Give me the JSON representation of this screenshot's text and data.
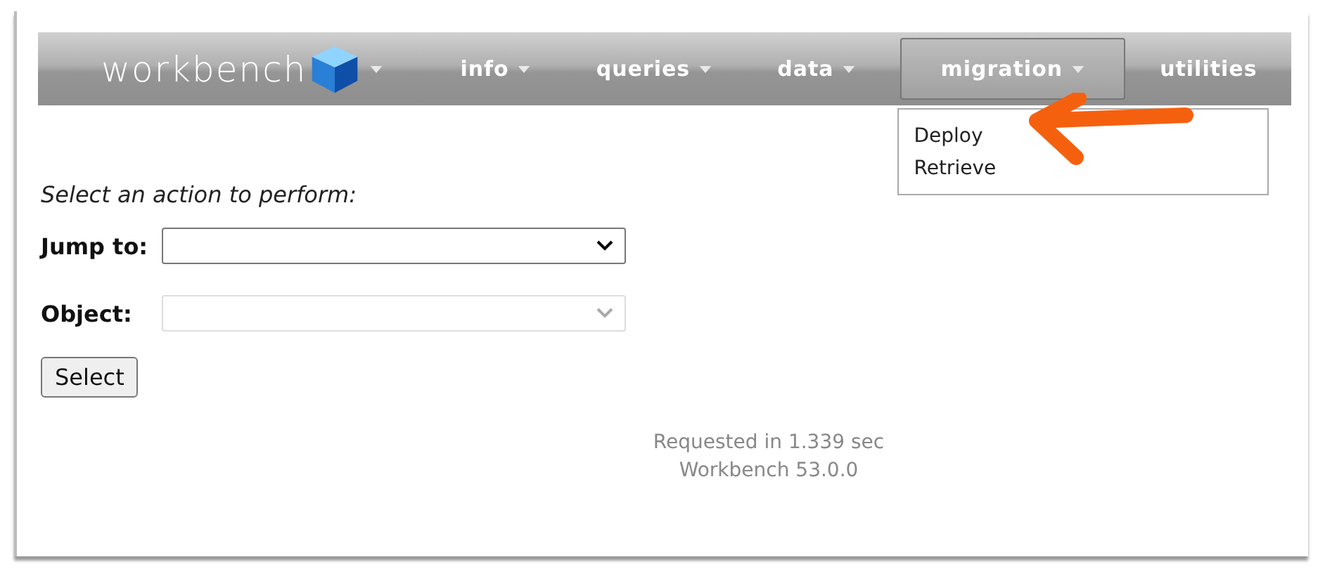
{
  "nav": {
    "logo": "workbench",
    "items": [
      {
        "label": "info",
        "caret": true,
        "selected": false
      },
      {
        "label": "queries",
        "caret": true,
        "selected": false
      },
      {
        "label": "data",
        "caret": true,
        "selected": false
      },
      {
        "label": "migration",
        "caret": true,
        "selected": true
      },
      {
        "label": "utilities",
        "caret": false,
        "selected": false
      }
    ]
  },
  "menu": {
    "items": [
      "Deploy",
      "Retrieve"
    ]
  },
  "prompt": "Select an action to perform:",
  "fields": [
    {
      "label": "Jump to:",
      "disabled": false
    },
    {
      "label": "Object:",
      "disabled": true
    }
  ],
  "button": "Select",
  "footer": [
    "Requested in 1.339 sec",
    "Workbench 53.0.0"
  ],
  "annotation": {
    "kind": "arrow"
  }
}
